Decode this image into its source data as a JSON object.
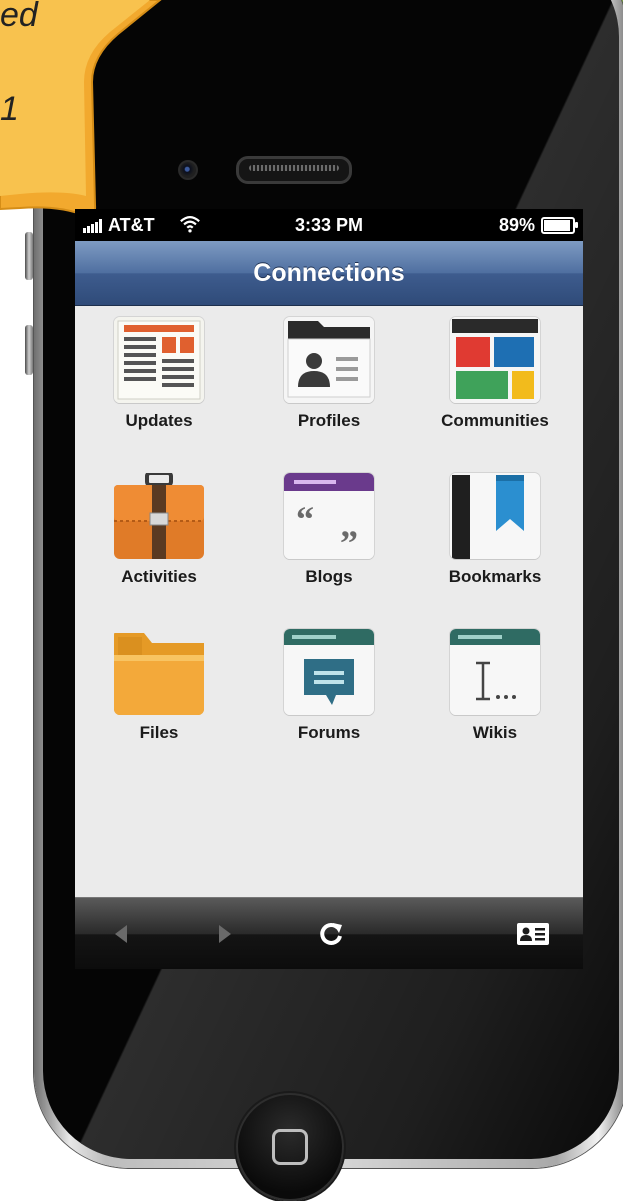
{
  "status_bar": {
    "carrier": "AT&T",
    "time": "3:33 PM",
    "battery_percent": "89%"
  },
  "nav": {
    "title": "Connections"
  },
  "apps": [
    {
      "label": "Updates",
      "icon": "updates-newspaper-icon"
    },
    {
      "label": "Profiles",
      "icon": "profiles-card-icon"
    },
    {
      "label": "Communities",
      "icon": "communities-blocks-icon"
    },
    {
      "label": "Activities",
      "icon": "activities-briefcase-icon"
    },
    {
      "label": "Blogs",
      "icon": "blogs-quote-icon"
    },
    {
      "label": "Bookmarks",
      "icon": "bookmarks-ribbon-icon"
    },
    {
      "label": "Files",
      "icon": "files-folder-icon"
    },
    {
      "label": "Forums",
      "icon": "forums-speech-bubble-icon"
    },
    {
      "label": "Wikis",
      "icon": "wikis-text-cursor-icon"
    }
  ],
  "toolbar": {
    "items": [
      "back-arrow-icon",
      "forward-arrow-icon",
      "refresh-icon",
      "contact-card-icon"
    ]
  },
  "banner": {
    "text_line1": "ed",
    "text_line2": "1",
    "color": "#f5b73b"
  },
  "colors": {
    "nav_bar": "#3e5c8e",
    "screen_bg": "#ebebeb",
    "banner": "#f5b73b"
  }
}
